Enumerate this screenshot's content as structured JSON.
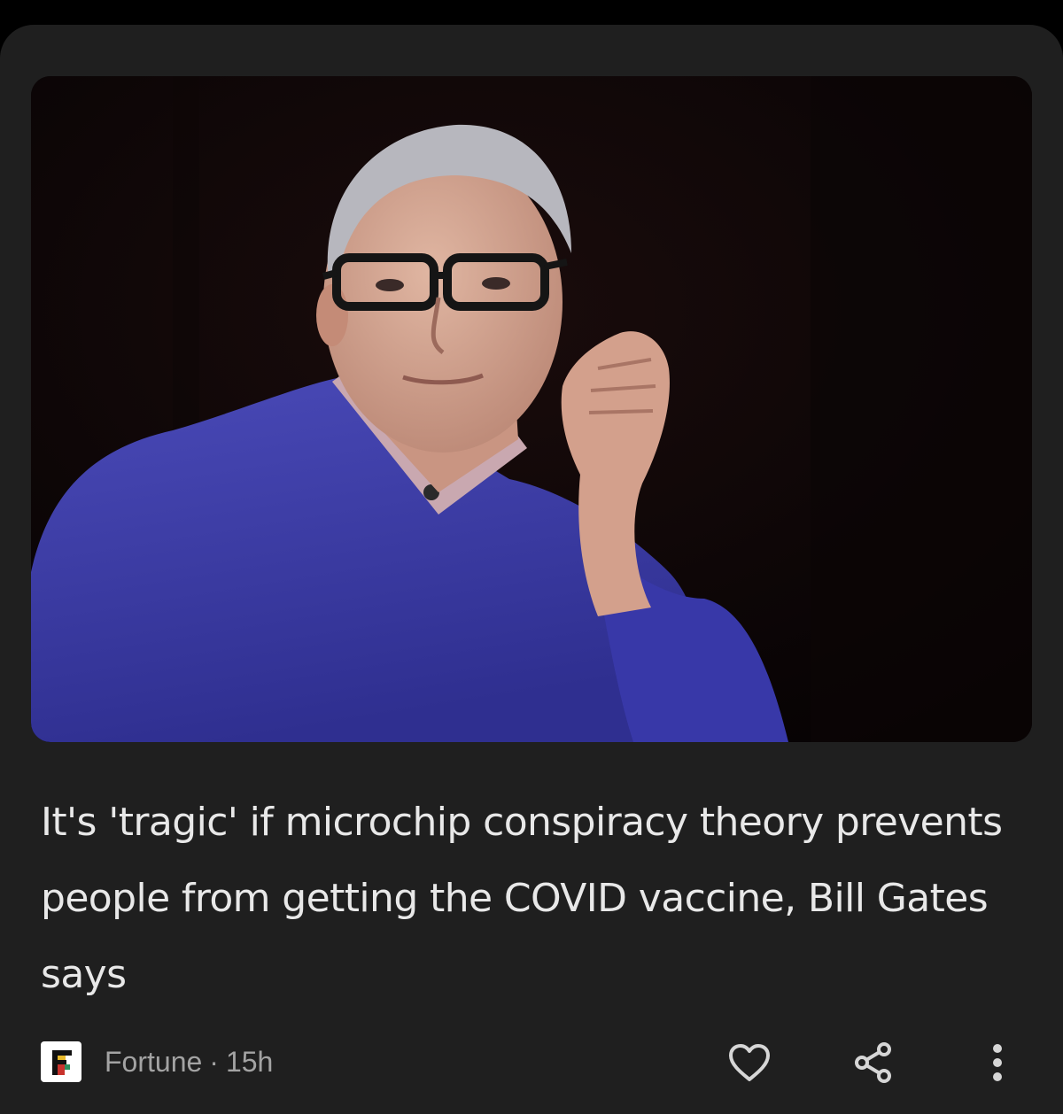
{
  "article": {
    "headline": "It's 'tragic' if microchip conspiracy theory prevents people from getting the COVID vaccine, Bill Gates says",
    "image_icon": "photo-man-in-blue-sweater-and-glasses"
  },
  "source": {
    "name": "Fortune",
    "separator": "·",
    "age": "15h",
    "logo_icon": "fortune-f-logo"
  },
  "actions": {
    "like_icon": "heart-icon",
    "share_icon": "share-icon",
    "more_icon": "more-vertical-icon"
  },
  "colors": {
    "background": "#000000",
    "card": "#1f1f1f",
    "headline_text": "#e8e8e8",
    "meta_text": "#a3a3a3",
    "icon": "#d6d6d6"
  }
}
